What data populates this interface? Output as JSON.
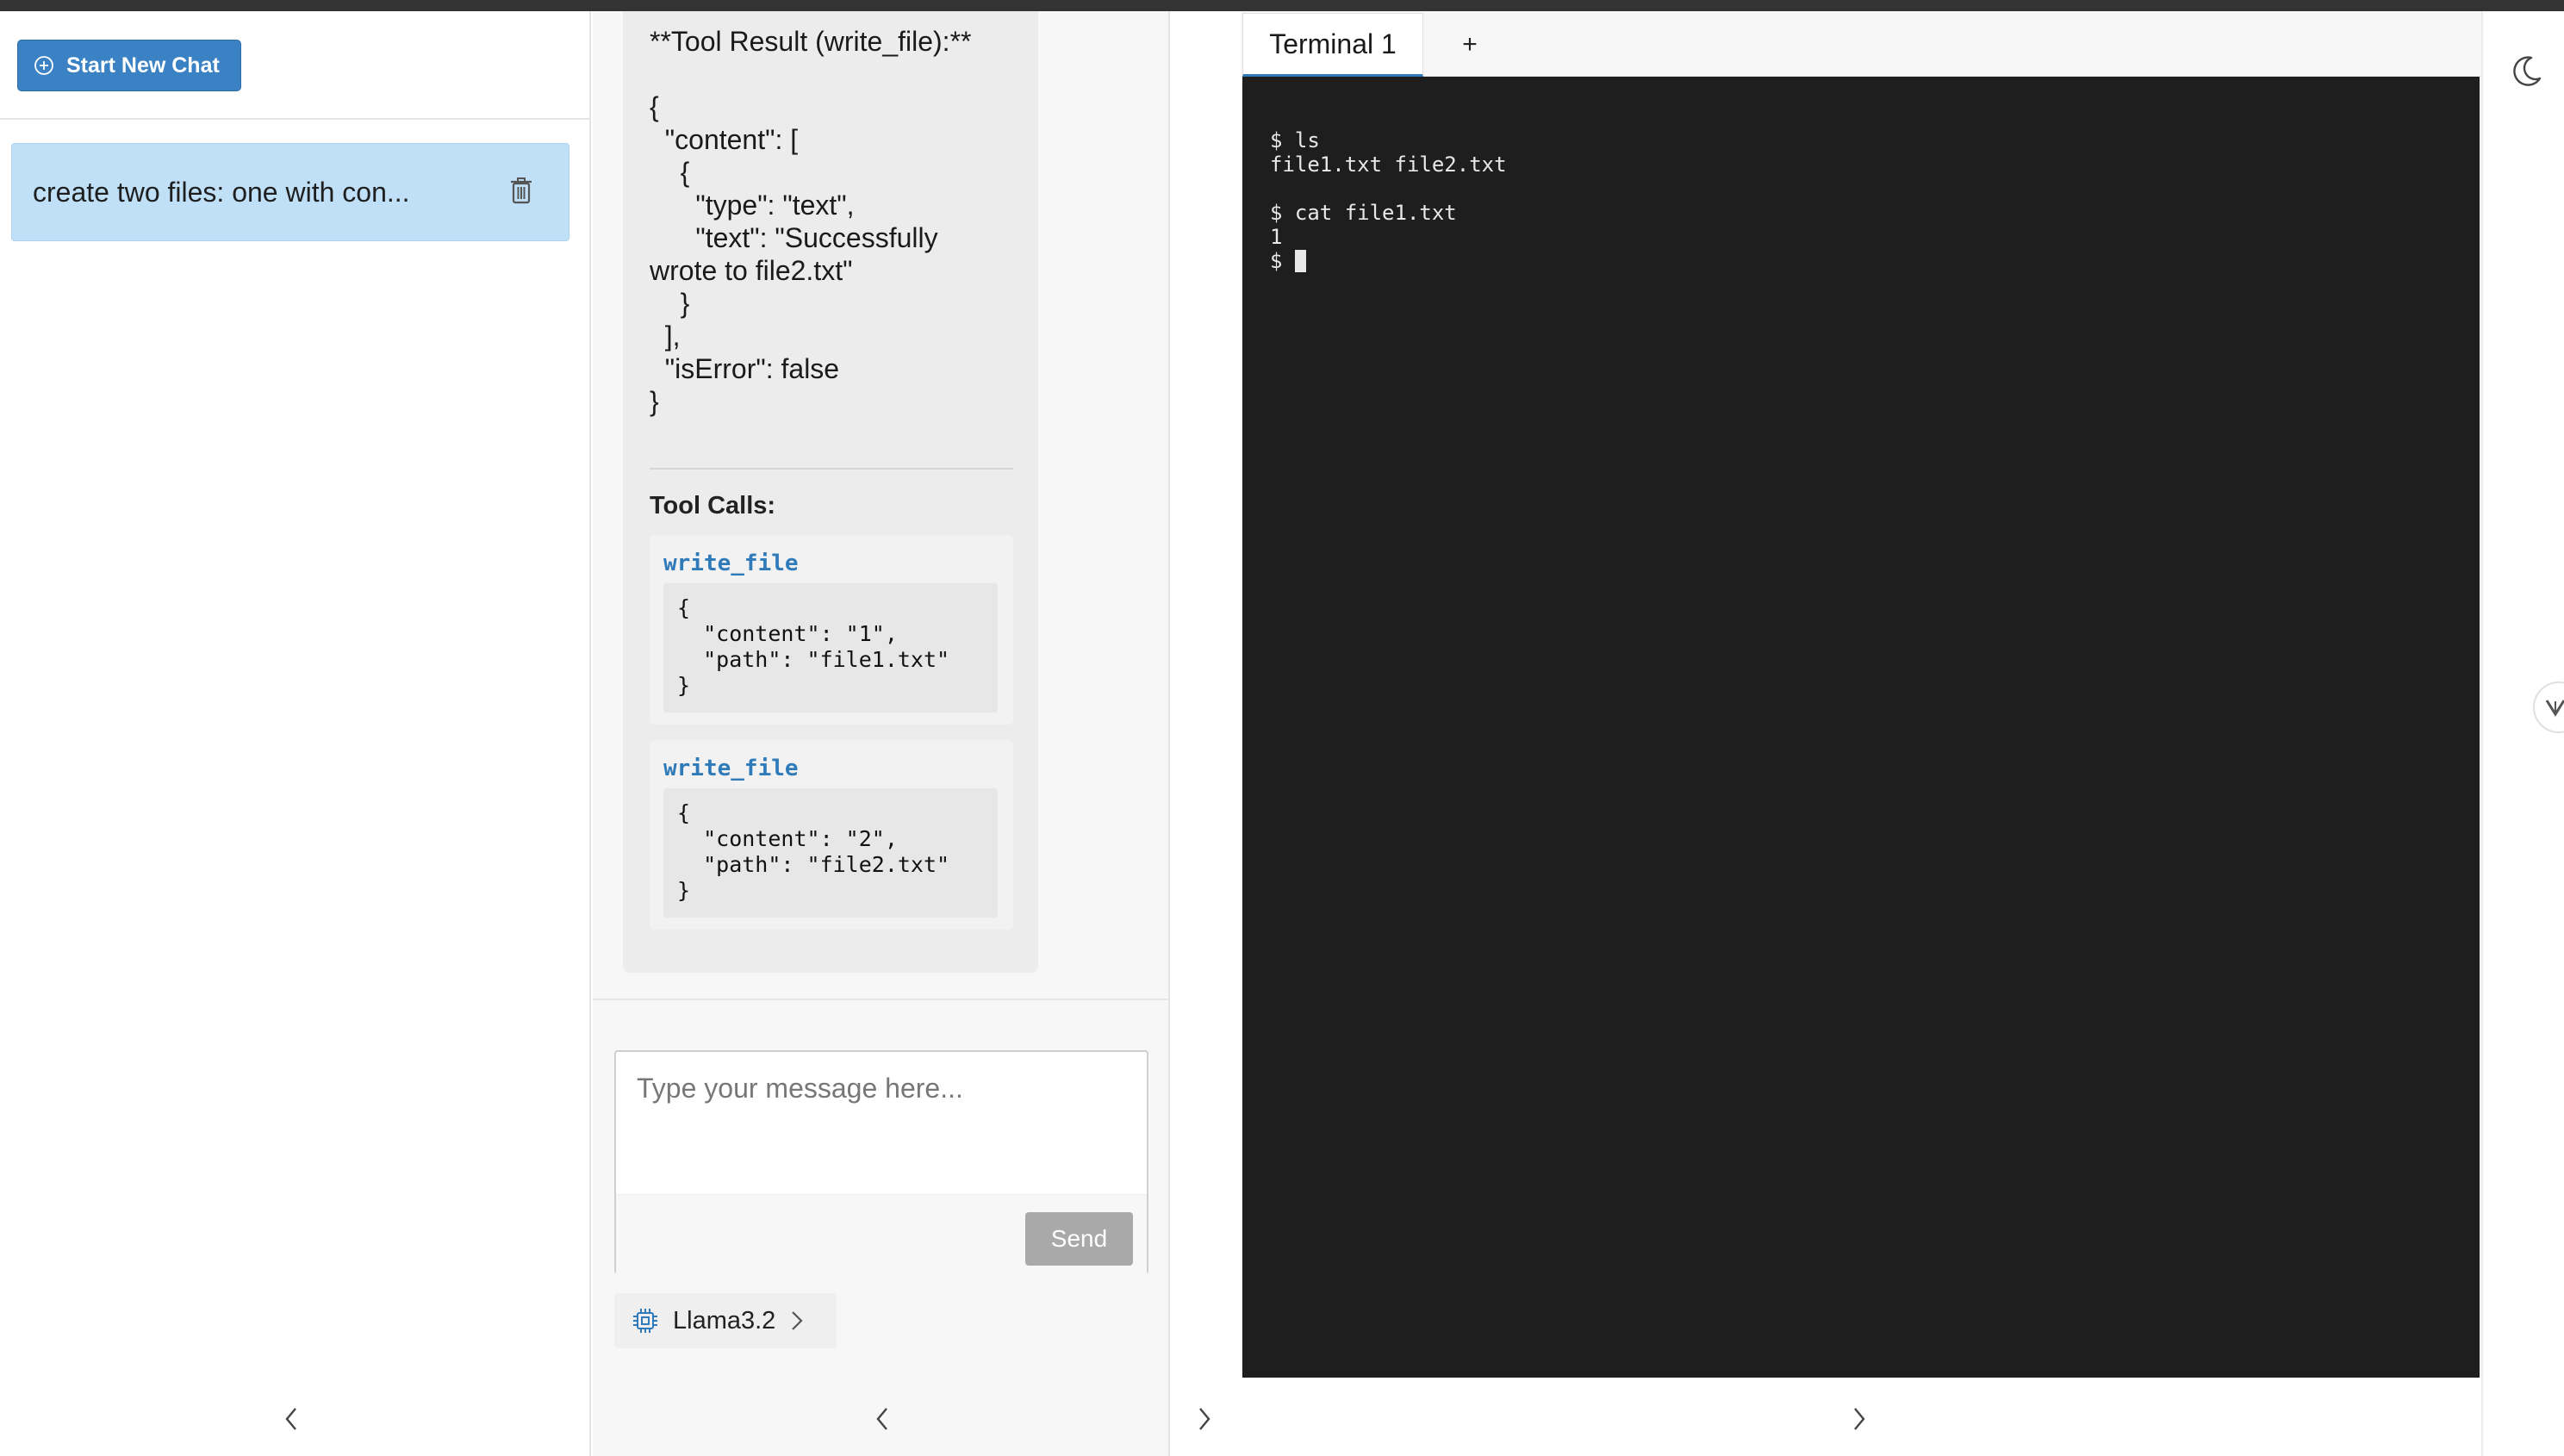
{
  "sidebar": {
    "new_chat_label": "Start New Chat",
    "chats": [
      {
        "title": "create two files: one with con..."
      }
    ]
  },
  "chat": {
    "tool_result_lines": [
      "**Tool Result (write_file):**",
      "",
      "{",
      "  \"content\": [",
      "    {",
      "      \"type\": \"text\",",
      "      \"text\": \"Successfully",
      "wrote to file2.txt\"",
      "    }",
      "  ],",
      "  \"isError\": false",
      "}"
    ],
    "tool_calls_label": "Tool Calls:",
    "tool_calls": [
      {
        "name": "write_file",
        "args": "{\n  \"content\": \"1\",\n  \"path\": \"file1.txt\"\n}"
      },
      {
        "name": "write_file",
        "args": "{\n  \"content\": \"2\",\n  \"path\": \"file2.txt\"\n}"
      }
    ],
    "input_placeholder": "Type your message here...",
    "send_label": "Send",
    "model_name": "Llama3.2"
  },
  "terminal": {
    "tabs": [
      {
        "label": "Terminal 1"
      }
    ],
    "add_tab_label": "+",
    "output": "$ ls\nfile1.txt file2.txt\n\n$ cat file1.txt\n1\n$ "
  },
  "icons": {
    "new_chat": "plus-circle-icon",
    "delete": "trash-icon",
    "model": "chip-icon",
    "theme": "moon-icon",
    "scroll": "chevron-down-icon"
  },
  "colors": {
    "accent": "#3a82c4",
    "selected_chat": "#bfe0f7",
    "terminal_bg": "#1e1e1e",
    "tool_name": "#2f7ab9",
    "send_disabled": "#a9a9a9"
  }
}
